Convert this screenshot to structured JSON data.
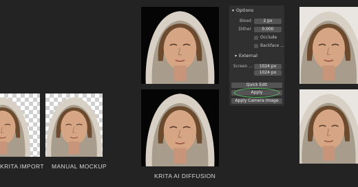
{
  "captions": {
    "krita_import": "KRITA IMPORT",
    "manual_mockup": "MANUAL MOCKUP",
    "krita_ai": "KRITA AI DIFFUSION"
  },
  "panel": {
    "options_header": "Options",
    "bleed_label": "Bleed",
    "bleed_value": "2 px",
    "dither_label": "Dither",
    "dither_value": "0.000",
    "occlude_label": "Occlude",
    "backface_label": "Backface ...",
    "external_header": "External",
    "screen_label": "Screen ...",
    "screen_x": "1024 px",
    "screen_y": "1024 px",
    "quick_edit": "Quick Edit",
    "apply": "Apply",
    "apply_camera": "Apply Camera Image"
  },
  "colors": {
    "background": "#232323",
    "panel": "#303030",
    "field": "#545454",
    "highlight_ring": "#5dc766"
  }
}
